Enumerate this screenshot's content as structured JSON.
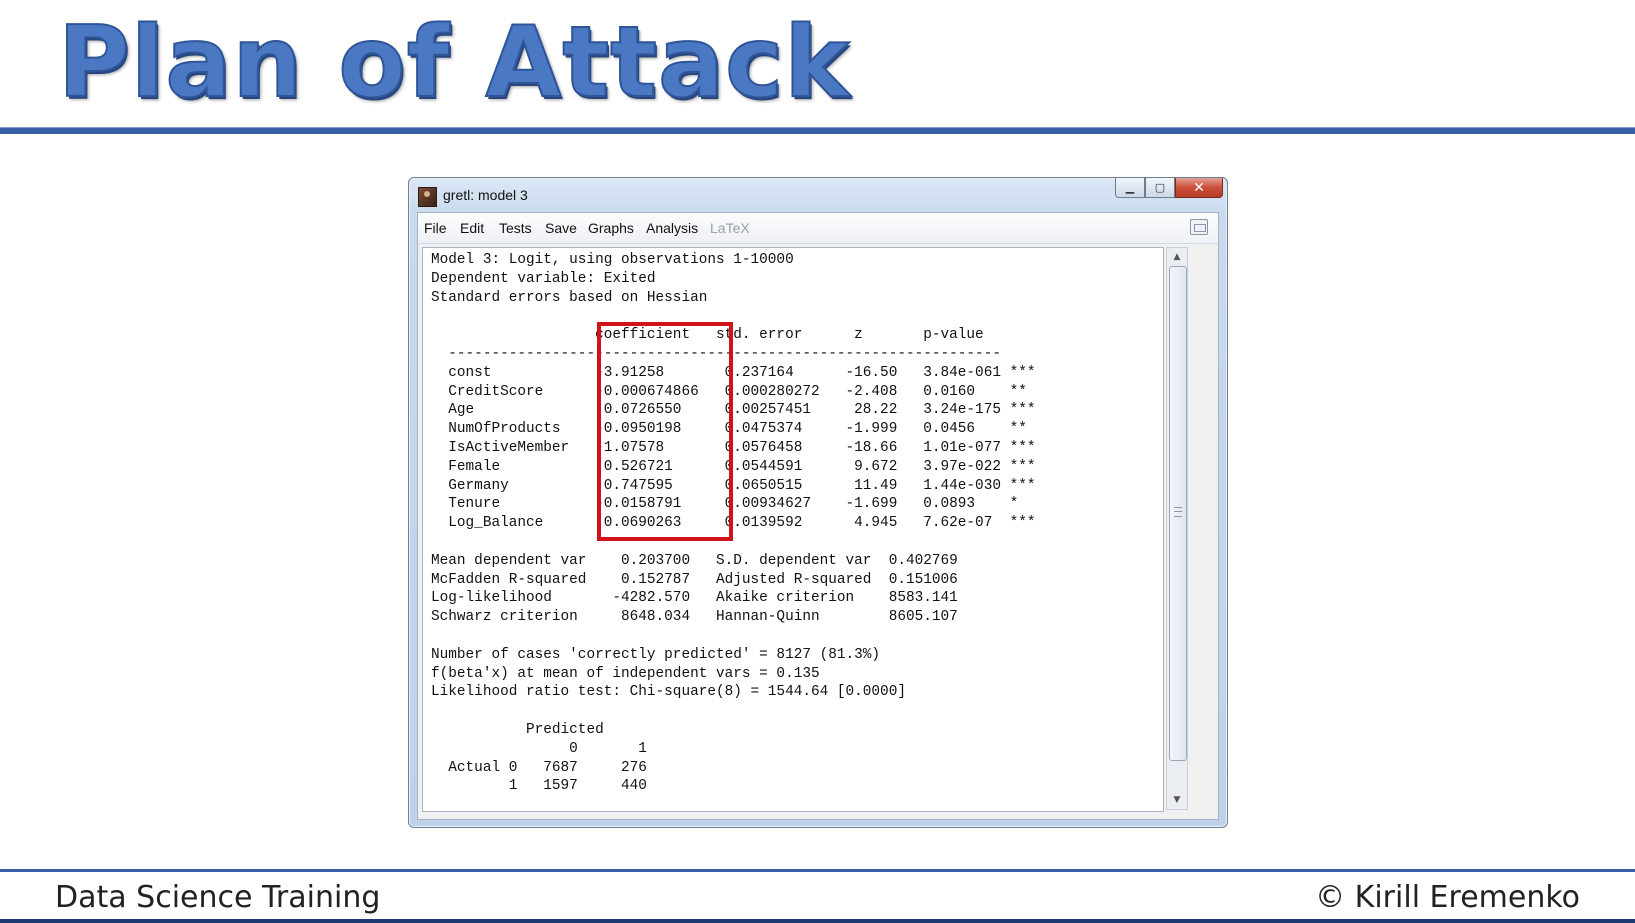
{
  "slide": {
    "title": "Plan of Attack",
    "footer_left": "Data Science Training",
    "footer_right": "© Kirill Eremenko"
  },
  "window": {
    "title": "gretl: model 3",
    "buttons": [
      "minimize",
      "maximize",
      "close"
    ]
  },
  "menu": {
    "file": "File",
    "edit": "Edit",
    "tests": "Tests",
    "save": "Save",
    "graphs": "Graphs",
    "analysis": "Analysis",
    "latex": "LaTeX"
  },
  "output": {
    "header": [
      "Model 3: Logit, using observations 1-10000",
      "Dependent variable: Exited",
      "Standard errors based on Hessian"
    ],
    "columns": [
      "coefficient",
      "std. error",
      "z",
      "p-value"
    ],
    "rows": [
      {
        "name": "const",
        "coef": "-3.91258",
        "se": "0.237164",
        "z": "-16.50",
        "p": "3.84e-061",
        "sig": "***"
      },
      {
        "name": "CreditScore",
        "coef": "-0.000674866",
        "se": "0.000280272",
        "z": "-2.408",
        "p": "0.0160",
        "sig": "**"
      },
      {
        "name": "Age",
        "coef": "0.0726550",
        "se": "0.00257451",
        "z": "28.22",
        "p": "3.24e-175",
        "sig": "***"
      },
      {
        "name": "NumOfProducts",
        "coef": "-0.0950198",
        "se": "0.0475374",
        "z": "-1.999",
        "p": "0.0456",
        "sig": "**"
      },
      {
        "name": "IsActiveMember",
        "coef": "-1.07578",
        "se": "0.0576458",
        "z": "-18.66",
        "p": "1.01e-077",
        "sig": "***"
      },
      {
        "name": "Female",
        "coef": "0.526721",
        "se": "0.0544591",
        "z": "9.672",
        "p": "3.97e-022",
        "sig": "***"
      },
      {
        "name": "Germany",
        "coef": "0.747595",
        "se": "0.0650515",
        "z": "11.49",
        "p": "1.44e-030",
        "sig": "***"
      },
      {
        "name": "Tenure",
        "coef": "-0.0158791",
        "se": "0.00934627",
        "z": "-1.699",
        "p": "0.0893",
        "sig": "*"
      },
      {
        "name": "Log_Balance",
        "coef": "0.0690263",
        "se": "0.0139592",
        "z": "4.945",
        "p": "7.62e-07",
        "sig": "***"
      }
    ],
    "stats": [
      {
        "l1": "Mean dependent var",
        "v1": "0.203700",
        "l2": "S.D. dependent var",
        "v2": "0.402769"
      },
      {
        "l1": "McFadden R-squared",
        "v1": "0.152787",
        "l2": "Adjusted R-squared",
        "v2": "0.151006"
      },
      {
        "l1": "Log-likelihood",
        "v1": "-4282.570",
        "l2": "Akaike criterion",
        "v2": "8583.141"
      },
      {
        "l1": "Schwarz criterion",
        "v1": "8648.034",
        "l2": "Hannan-Quinn",
        "v2": "8605.107"
      }
    ],
    "notes": [
      "Number of cases 'correctly predicted' = 8127 (81.3%)",
      "f(beta'x) at mean of independent vars = 0.135",
      "Likelihood ratio test: Chi-square(8) = 1544.64 [0.0000]"
    ],
    "confusion": {
      "title": "Predicted",
      "cols": [
        "0",
        "1"
      ],
      "row_label": "Actual",
      "rows": [
        {
          "label": "0",
          "values": [
            "7687",
            "276"
          ]
        },
        {
          "label": "1",
          "values": [
            "1597",
            "440"
          ]
        }
      ]
    }
  }
}
